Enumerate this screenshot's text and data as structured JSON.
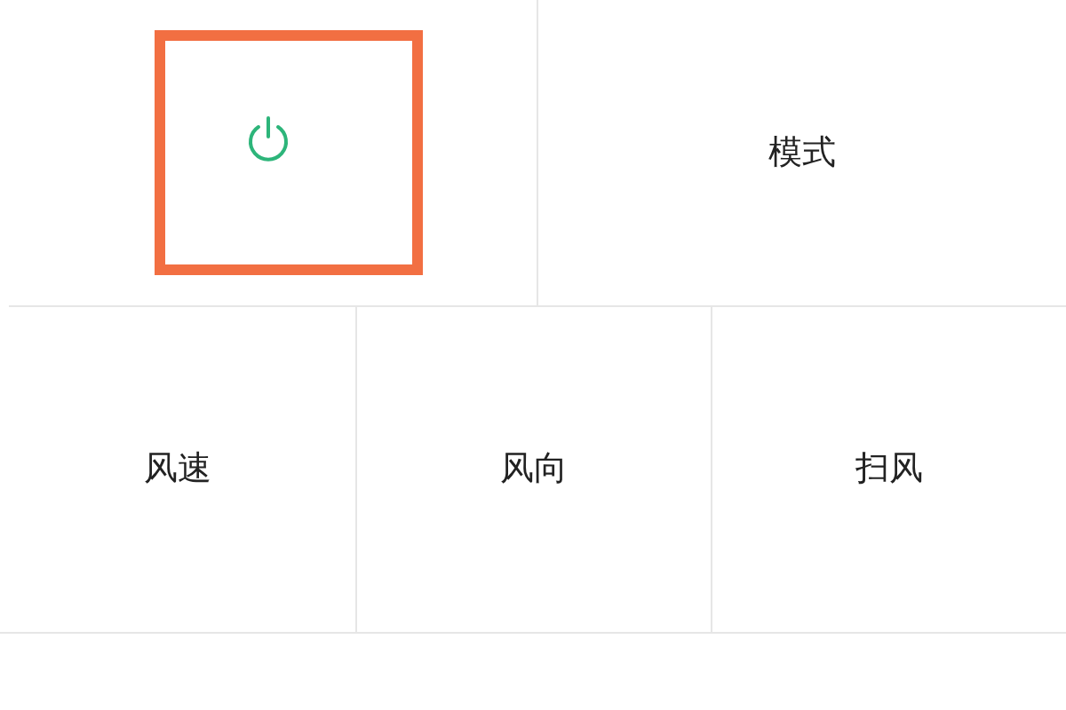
{
  "top_row": [
    {
      "kind": "power",
      "highlighted": true
    },
    {
      "kind": "text",
      "label": "模式",
      "highlighted": false
    }
  ],
  "bottom_row": [
    {
      "label": "风速"
    },
    {
      "label": "风向"
    },
    {
      "label": "扫风"
    }
  ]
}
